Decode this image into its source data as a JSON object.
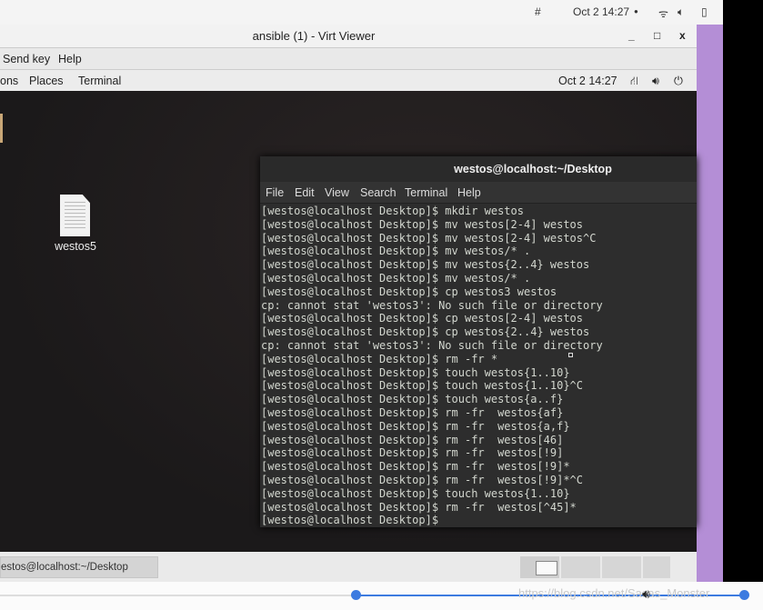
{
  "host_topbar": {
    "date_time": "Oct 2  14:27",
    "icons": [
      "grid-icon",
      "record-dot-icon",
      "wifi-icon",
      "volume-icon",
      "battery-icon"
    ]
  },
  "virt_viewer": {
    "title": "ansible (1) - Virt Viewer",
    "menu": [
      "Send key",
      "Help"
    ]
  },
  "guest_topbar": {
    "menu": [
      "ons",
      "Places",
      "Terminal"
    ],
    "date_time": "Oct 2  14:27",
    "icons": [
      "network-icon",
      "volume-icon",
      "power-icon"
    ]
  },
  "desktop": {
    "file_label": "westos5"
  },
  "terminal": {
    "title": "westos@localhost:~/Desktop",
    "menu": [
      "File",
      "Edit",
      "View",
      "Search",
      "Terminal",
      "Help"
    ],
    "lines": [
      "[westos@localhost Desktop]$ mkdir westos",
      "[westos@localhost Desktop]$ mv westos[2-4] westos",
      "[westos@localhost Desktop]$ mv westos[2-4] westos^C",
      "[westos@localhost Desktop]$ mv westos/* .",
      "[westos@localhost Desktop]$ mv westos{2..4} westos",
      "[westos@localhost Desktop]$ mv westos/* .",
      "[westos@localhost Desktop]$ cp westos3 westos",
      "cp: cannot stat 'westos3': No such file or directory",
      "[westos@localhost Desktop]$ cp westos[2-4] westos",
      "[westos@localhost Desktop]$ cp westos{2..4} westos",
      "cp: cannot stat 'westos3': No such file or directory",
      "[westos@localhost Desktop]$ rm -fr *",
      "[westos@localhost Desktop]$ touch westos{1..10}",
      "[westos@localhost Desktop]$ touch westos{1..10}^C",
      "[westos@localhost Desktop]$ touch westos{a..f}",
      "[westos@localhost Desktop]$ rm -fr  westos{af}",
      "[westos@localhost Desktop]$ rm -fr  westos{a,f}",
      "[westos@localhost Desktop]$ rm -fr  westos[46]",
      "[westos@localhost Desktop]$ rm -fr  westos[!9]",
      "[westos@localhost Desktop]$ rm -fr  westos[!9]*",
      "[westos@localhost Desktop]$ rm -fr  westos[!9]*^C",
      "[westos@localhost Desktop]$ touch westos{1..10}",
      "[westos@localhost Desktop]$ rm -fr  westos[^45]*",
      "[westos@localhost Desktop]$ "
    ]
  },
  "taskbar": {
    "window_item": "estos@localhost:~/Desktop"
  },
  "player": {
    "progress_percent": 46,
    "watermark": "https://blog.csdn.net/Sasas_Monster"
  },
  "colors": {
    "accent": "#3c7be0",
    "terminal_bg": "#2d2d2d",
    "terminal_fg": "#d3d7cf"
  }
}
